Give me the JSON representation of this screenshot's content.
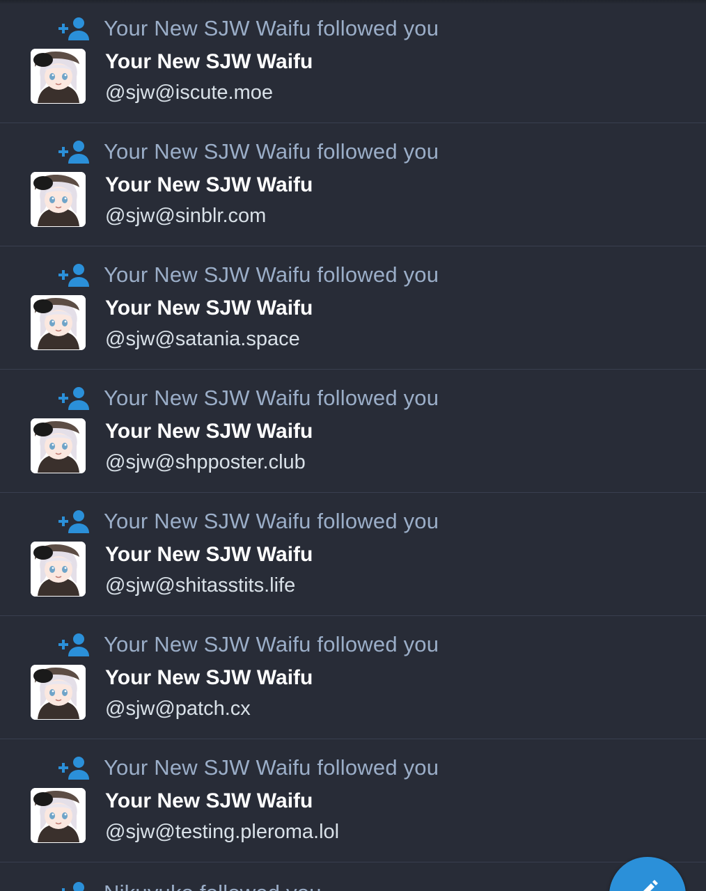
{
  "notifications": [
    {
      "message": "Your New SJW Waifu followed you",
      "display_name": "Your New SJW Waifu",
      "acct": "@sjw@iscute.moe"
    },
    {
      "message": "Your New SJW Waifu followed you",
      "display_name": "Your New SJW Waifu",
      "acct": "@sjw@sinblr.com"
    },
    {
      "message": "Your New SJW Waifu followed you",
      "display_name": "Your New SJW Waifu",
      "acct": "@sjw@satania.space"
    },
    {
      "message": "Your New SJW Waifu followed you",
      "display_name": "Your New SJW Waifu",
      "acct": "@sjw@shpposter.club"
    },
    {
      "message": "Your New SJW Waifu followed you",
      "display_name": "Your New SJW Waifu",
      "acct": "@sjw@shitasstits.life"
    },
    {
      "message": "Your New SJW Waifu followed you",
      "display_name": "Your New SJW Waifu",
      "acct": "@sjw@patch.cx"
    },
    {
      "message": "Your New SJW Waifu followed you",
      "display_name": "Your New SJW Waifu",
      "acct": "@sjw@testing.pleroma.lol"
    }
  ],
  "partial_notification": {
    "message": "Nikuyuko followed you"
  },
  "icons": {
    "follow": "person-add-icon",
    "compose": "pencil-icon"
  },
  "colors": {
    "background": "#282c37",
    "accent": "#2b90d9",
    "muted_text": "#9baec8",
    "name_text": "#ffffff",
    "divider": "#393f4f"
  }
}
